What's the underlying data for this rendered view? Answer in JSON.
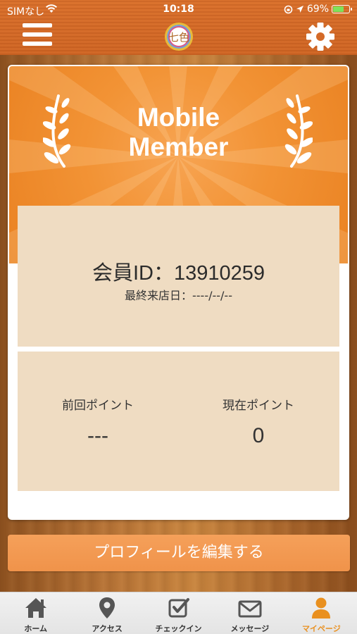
{
  "status_bar": {
    "carrier": "SIMなし",
    "time": "10:18",
    "battery": "69%",
    "battery_level": 0.69
  },
  "header": {
    "logo_text": "七色",
    "menu_icon": "hamburger-menu-icon",
    "settings_icon": "gear-icon"
  },
  "card": {
    "banner_title_line1": "Mobile",
    "banner_title_line2": "Member",
    "member_id": "会員ID：13910259",
    "last_visit": "最終来店日：----/--/--",
    "previous_points_label": "前回ポイント",
    "previous_points_value": "---",
    "current_points_label": "現在ポイント",
    "current_points_value": "0"
  },
  "edit_profile_label": "プロフィールを編集する",
  "tabs": [
    {
      "label": "ホーム",
      "icon": "home-icon"
    },
    {
      "label": "アクセス",
      "icon": "map-pin-icon"
    },
    {
      "label": "チェックイン",
      "icon": "checkbox-icon"
    },
    {
      "label": "メッセージ",
      "icon": "envelope-icon"
    },
    {
      "label": "マイページ",
      "icon": "person-icon",
      "active": true
    }
  ],
  "colors": {
    "accent": "#f0934a",
    "header": "#d96f2b",
    "panel": "#efdcc2",
    "active_tab": "#e9901f"
  }
}
